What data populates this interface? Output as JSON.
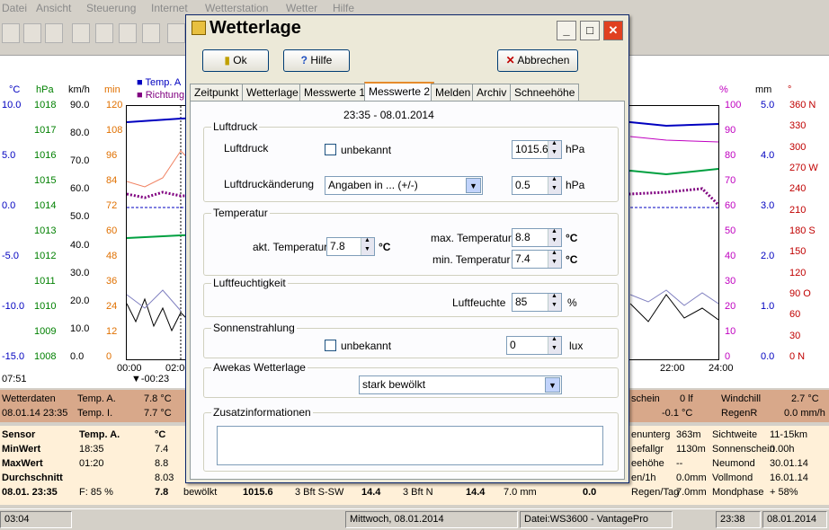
{
  "menu": [
    "Datei",
    "Ansicht",
    "Steuerung",
    "Internet",
    "Wetterstation",
    "Wetter",
    "Hilfe"
  ],
  "chart": {
    "units": [
      "°C",
      "hPa",
      "km/h",
      "min"
    ],
    "legend": [
      "Temp. A",
      "Richtung"
    ],
    "left_c": [
      "10.0",
      "5.0",
      "0.0",
      "-5.0",
      "-10.0",
      "-15.0"
    ],
    "left_hpa": [
      "1018",
      "1017",
      "1016",
      "1015",
      "1014",
      "1013",
      "1012",
      "1011",
      "1010",
      "1009",
      "1008"
    ],
    "left_kmh": [
      "90.0",
      "80.0",
      "70.0",
      "60.0",
      "50.0",
      "40.0",
      "30.0",
      "20.0",
      "10.0",
      "0.0"
    ],
    "left_min": [
      "120",
      "108",
      "96",
      "84",
      "72",
      "60",
      "48",
      "36",
      "24",
      "12",
      "0"
    ],
    "right_units": [
      "%",
      "mm",
      "°"
    ],
    "right_pct": [
      "100",
      "90",
      "80",
      "70",
      "60",
      "50",
      "40",
      "30",
      "20",
      "10",
      "0"
    ],
    "right_mm": [
      "5.0",
      "4.0",
      "3.0",
      "2.0",
      "1.0",
      "0.0"
    ],
    "right_deg": [
      "360 N",
      "330",
      "300",
      "270 W",
      "240",
      "210",
      "180 S",
      "150",
      "120",
      "90 O",
      "60",
      "30",
      "0 N"
    ],
    "times": [
      "00:00",
      "02:00",
      "22:00",
      "24:00"
    ],
    "time_marker": "-00:23",
    "clock": "07:51"
  },
  "row1": {
    "a": "Wetterdaten",
    "b": "08.01.14 23:35",
    "c": "Temp. A.",
    "d": "7.8 °C",
    "e": "Temp. I.",
    "f": "7.7 °C",
    "g": "schein",
    "h": "0 lf",
    "i": "-0.1 °C",
    "j": "Windchill",
    "k": "2.7 °C",
    "l": "RegenR",
    "m": "0.0 mm/h"
  },
  "sensor": {
    "labels": [
      "Sensor",
      "MinWert",
      "MaxWert",
      "Durchschnitt",
      "08.01. 23:35"
    ],
    "col1": [
      "Temp. A.",
      "18:35",
      "01:20",
      "",
      "F: 85 %"
    ],
    "col2": [
      "°C",
      "7.4",
      "8.8",
      "8.03",
      "7.8"
    ],
    "bottom": [
      "bewölkt",
      "1015.6",
      "3 Bft S-SW",
      "14.4",
      "3 Bft N",
      "14.4",
      "7.0 mm",
      "0.0"
    ],
    "rightA": [
      "enunterg",
      "eefallgr",
      "eehöhe",
      "en/1h",
      "Regen/Tag"
    ],
    "rightA_v": [
      "363m",
      "1130m",
      "--",
      "0.0mm",
      "7.0mm"
    ],
    "rightB": [
      "Sichtweite",
      "Sonnenschein",
      "Neumond",
      "Vollmond",
      "Mondphase"
    ],
    "rightB_v": [
      "11-15km",
      "0.00h",
      "30.01.14",
      "16.01.14",
      "+ 58%"
    ]
  },
  "status": {
    "left": "03:04",
    "date": "Mittwoch, 08.01.2014",
    "file": "Datei:WS3600 - VantagePro",
    "time": "23:38",
    "date2": "08.01.2014"
  },
  "dialog": {
    "title": "Wetterlage",
    "ok": "Ok",
    "help": "Hilfe",
    "cancel": "Abbrechen",
    "tabs": [
      "Zeitpunkt",
      "Wetterlage",
      "Messwerte 1",
      "Messwerte 2",
      "Melden",
      "Archiv",
      "Schneehöhe"
    ],
    "timestamp": "23:35  -  08.01.2014",
    "g_luftdruck": "Luftdruck",
    "luftdruck": "Luftdruck",
    "unbekannt": "unbekannt",
    "luftdruck_val": "1015.6",
    "hpa": "hPa",
    "aenderung": "Luftdruckänderung",
    "aenderung_sel": "Angaben in ... (+/-)",
    "aenderung_val": "0.5",
    "g_temp": "Temperatur",
    "akt": "akt. Temperatur",
    "akt_val": "7.8",
    "c": "°C",
    "max": "max. Temperatur",
    "max_val": "8.8",
    "min": "min. Temperatur",
    "min_val": "7.4",
    "g_feuchte": "Luftfeuchtigkeit",
    "feuchte": "Luftfeuchte",
    "feuchte_val": "85",
    "pct": "%",
    "g_sonne": "Sonnenstrahlung",
    "sonne_val": "0",
    "lux": "lux",
    "g_awekas": "Awekas Wetterlage",
    "awekas_sel": "stark bewölkt",
    "g_zusatz": "Zusatzinformationen",
    "zusatz_val": ""
  }
}
